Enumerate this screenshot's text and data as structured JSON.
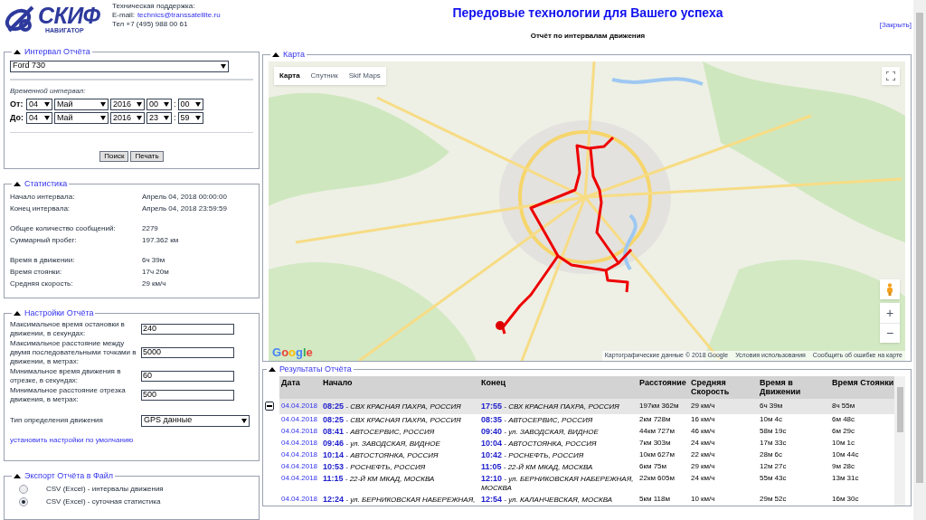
{
  "header": {
    "logo_title": "СКИФ",
    "logo_subtitle": "НАВИГАТОР",
    "support_title": "Техническая поддержка:",
    "email_label": "E-mail:",
    "email": "technics@transsatellite.ru",
    "phone": "Тел +7 (495) 988 00 61",
    "headline": "Передовые технологии для Вашего успеха",
    "report_title": "Отчёт по интервалам движения",
    "close_link": "[Закрыть]"
  },
  "interval_panel": {
    "legend": "Интервал Отчёта",
    "expanded": true,
    "vehicle": "Ford 730",
    "interval_label": "Временной интервал:",
    "ranges": [
      {
        "label": "От:",
        "day": "04",
        "month": "Май",
        "year": "2016",
        "hour": "00",
        "separator": ":",
        "minute": "00"
      },
      {
        "label": "До:",
        "day": "04",
        "month": "Май",
        "year": "2016",
        "hour": "23",
        "separator": ":",
        "minute": "59"
      }
    ],
    "buttons": [
      "Поиск",
      "Печать"
    ]
  },
  "statistics_panel": {
    "legend": "Статистика",
    "expanded": true,
    "groups": [
      [
        {
          "label": "Начало интервала:",
          "value": "Апрель 04, 2018 00:00:00"
        },
        {
          "label": "Конец интервала:",
          "value": "Апрель 04, 2018 23:59:59"
        }
      ],
      [
        {
          "label": "Общее количество сообщений:",
          "value": "2279"
        },
        {
          "label": "Суммарный пробег:",
          "value": "197.362 км"
        }
      ],
      [
        {
          "label": "Время в движении:",
          "value": "6ч 39м"
        },
        {
          "label": "Время стоянки:",
          "value": "17ч 20м"
        },
        {
          "label": "Средняя скорость:",
          "value": "29 км/ч"
        }
      ]
    ]
  },
  "settings_panel": {
    "legend": "Настройки Отчёта",
    "expanded": true,
    "fields": [
      {
        "label": "Максимальное время остановки в движении, в секундах:",
        "value": "240"
      },
      {
        "label": "Максимальное расстояние между двумя последовательными точками в движении, в метрах:",
        "value": "5000"
      },
      {
        "label": "Минимальное время движения в отрезке, в секундах:",
        "value": "60"
      },
      {
        "label": "Минимальное расстояние отрезка движения, в метрах:",
        "value": "500"
      }
    ],
    "movement_type": {
      "label": "Тип определения движения",
      "value": "GPS данные"
    },
    "reset_link": "установить настройки по умолчанию"
  },
  "export_panel": {
    "legend": "Экспорт Отчёта в Файл",
    "expanded": true,
    "options": [
      {
        "label": "CSV (Excel) - интервалы движения",
        "selected": false
      },
      {
        "label": "CSV (Excel) - суточная статистика",
        "selected": true
      }
    ]
  },
  "map_panel": {
    "legend": "Карта",
    "expanded": true,
    "map": {
      "kind": "picture"
    },
    "map_types": [
      {
        "label": "Карта",
        "selected": true
      },
      {
        "label": "Спутник",
        "selected": false
      },
      {
        "label": "Skif Maps",
        "selected": false
      }
    ],
    "logo": "Google",
    "zoom_in": "+",
    "zoom_out": "−",
    "attribution": [
      "Картографические данные © 2018 Google",
      "Условия использования",
      "Сообщить об ошибке на карте"
    ]
  },
  "results_panel": {
    "legend": "Результаты Отчёта",
    "expanded": true,
    "columns": [
      "Дата",
      "Начало",
      "Конец",
      "Расстояние",
      "Средняя Скорость",
      "Время в Движении",
      "Время Стоянки"
    ],
    "rows": [
      {
        "kind": "summary",
        "expanded": true,
        "date": "04.04.2018",
        "start": "**08:25** - СВХ КРАСНАЯ ПАХРА, РОССИЯ",
        "end": "**17:55** - СВХ КРАСНАЯ ПАХРА, РОССИЯ",
        "distance": "197км 362м",
        "speed": "29 км/ч",
        "moving": "6ч 39м",
        "stopped": "8ч 55м"
      },
      {
        "kind": "detail",
        "date": "04.04.2018",
        "start": "**08:25** - СВХ КРАСНАЯ ПАХРА, РОССИЯ",
        "end": "**08:35** - АВТОСЕРВИС, РОССИЯ",
        "distance": "2км 728м",
        "speed": "16 км/ч",
        "moving": "10м 4с",
        "stopped": "6м 48с"
      },
      {
        "kind": "detail",
        "date": "04.04.2018",
        "start": "**08:41** - АВТОСЕРВИС, РОССИЯ",
        "end": "**09:40** - ул. ЗАВОДСКАЯ, ВИДНОЕ",
        "distance": "44км 727м",
        "speed": "46 км/ч",
        "moving": "58м 19с",
        "stopped": "6м 29с"
      },
      {
        "kind": "detail",
        "date": "04.04.2018",
        "start": "**09:46** - ул. ЗАВОДСКАЯ, ВИДНОЕ",
        "end": "**10:04** - АВТОСТОЯНКА, РОССИЯ",
        "distance": "7км 303м",
        "speed": "24 км/ч",
        "moving": "17м 33с",
        "stopped": "10м 1с"
      },
      {
        "kind": "detail",
        "date": "04.04.2018",
        "start": "**10:14** - АВТОСТОЯНКА, РОССИЯ",
        "end": "**10:42** - РОСНЕФТЬ, РОССИЯ",
        "distance": "10км 627м",
        "speed": "22 км/ч",
        "moving": "28м 6с",
        "stopped": "10м 44с"
      },
      {
        "kind": "detail",
        "date": "04.04.2018",
        "start": "**10:53** - РОСНЕФТЬ, РОССИЯ",
        "end": "**11:05** - 22-Й КМ МКАД, МОСКВА",
        "distance": "6км 75м",
        "speed": "29 км/ч",
        "moving": "12м 27с",
        "stopped": "9м 28с"
      },
      {
        "kind": "detail",
        "date": "04.04.2018",
        "start": "**11:15** - 22-Й КМ МКАД, МОСКВА",
        "end": "**12:10** - ул. БЕРНИКОВСКАЯ НАБЕРЕЖНАЯ, МОСКВА",
        "distance": "22км 605м",
        "speed": "24 км/ч",
        "moving": "55м 43с",
        "stopped": "13м 31с"
      },
      {
        "kind": "detail",
        "date": "04.04.2018",
        "start": "**12:24** - ул. БЕРНИКОВСКАЯ НАБЕРЕЖНАЯ,",
        "end": "**12:54** - ул. КАЛАНЧЕВСКАЯ, МОСКВА",
        "distance": "5км 118м",
        "speed": "10 км/ч",
        "moving": "29м 52с",
        "stopped": "16м 30с"
      }
    ]
  }
}
